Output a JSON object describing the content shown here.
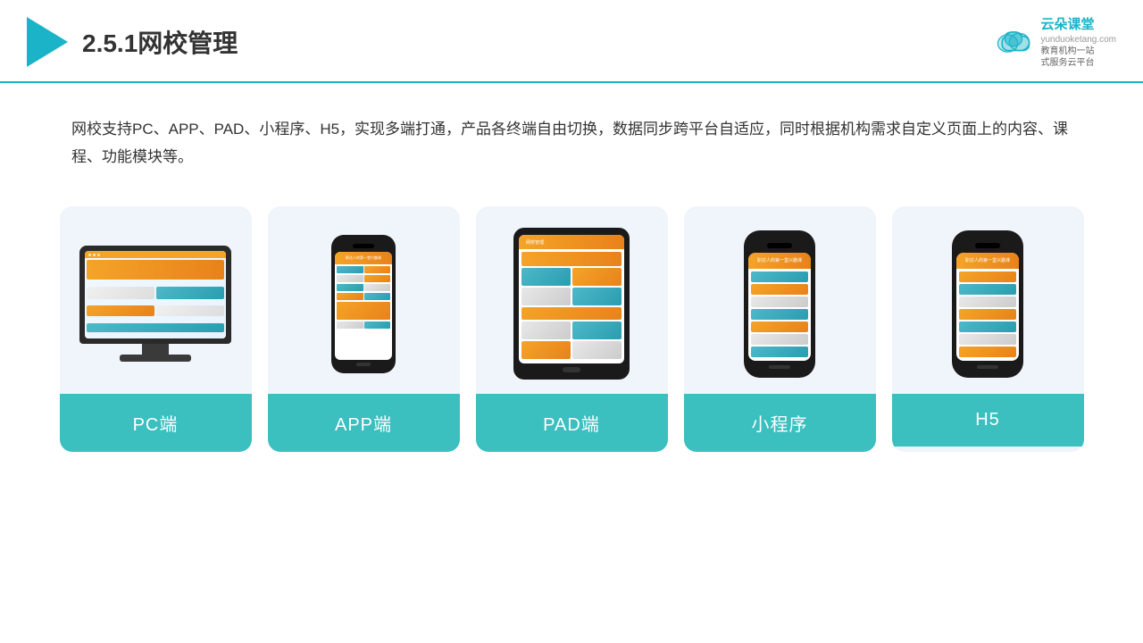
{
  "header": {
    "title": "2.5.1网校管理",
    "logo_brand": "云朵课堂",
    "logo_url": "yunduoketang.com",
    "logo_slogan1": "教育机构一站",
    "logo_slogan2": "式服务云平台"
  },
  "description": "网校支持PC、APP、PAD、小程序、H5，实现多端打通，产品各终端自由切换，数据同步跨平台自适应，同时根据机构需求自定义页面上的内容、课程、功能模块等。",
  "cards": [
    {
      "id": "pc",
      "label": "PC端"
    },
    {
      "id": "app",
      "label": "APP端"
    },
    {
      "id": "pad",
      "label": "PAD端"
    },
    {
      "id": "mini",
      "label": "小程序"
    },
    {
      "id": "h5",
      "label": "H5"
    }
  ]
}
